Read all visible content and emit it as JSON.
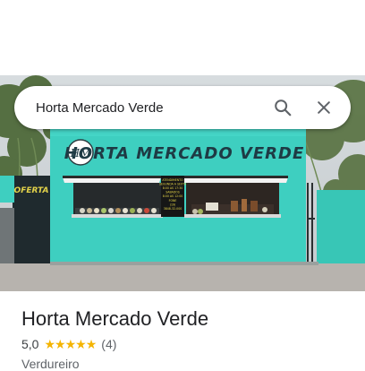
{
  "search": {
    "query": "Horta Mercado Verde",
    "search_icon": "search-icon",
    "close_icon": "close-icon"
  },
  "photo": {
    "sign_text": "HORTA MERCADO VERDE",
    "logo_text": "HM",
    "side_sign_text": "OFERTA",
    "notice_lines": [
      "ATENDIMENTO",
      "SEGUNDA A SEXTA",
      "8:00 AS 17:30",
      "SABADOS",
      "8:00 AS 12:00",
      "FONE",
      "(19)",
      "3848-32-000"
    ]
  },
  "place": {
    "name": "Horta Mercado Verde",
    "rating": "5,0",
    "stars": 5,
    "review_count": "(4)",
    "category": "Verdureiro"
  },
  "colors": {
    "wall": "#3ecfc0",
    "star": "#f4b400",
    "sign_text": "#1e3a44"
  }
}
